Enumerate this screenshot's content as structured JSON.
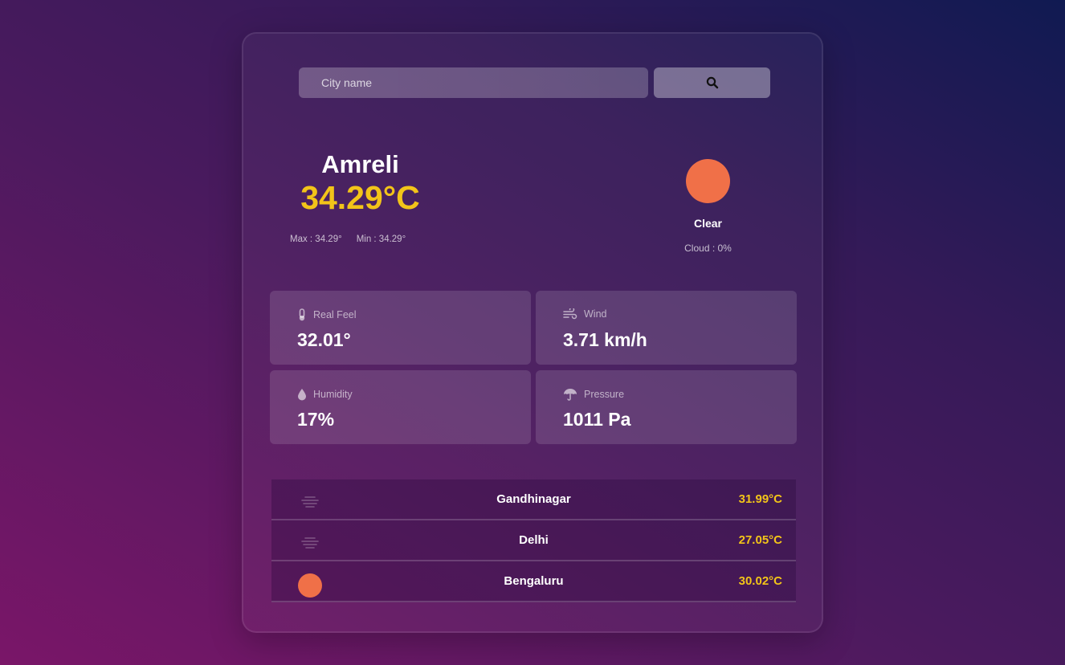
{
  "search": {
    "placeholder": "City name",
    "button_icon": "search-icon"
  },
  "current": {
    "city": "Amreli",
    "temperature": "34.29°C",
    "max": "Max : 34.29°",
    "min": "Min : 34.29°",
    "condition": "Clear",
    "condition_icon": "sun-icon",
    "cloud": "Cloud : 0%"
  },
  "details": [
    {
      "label": "Real Feel",
      "value": "32.01°",
      "icon": "thermometer-icon"
    },
    {
      "label": "Wind",
      "value": "3.71 km/h",
      "icon": "wind-icon"
    },
    {
      "label": "Humidity",
      "value": "17%",
      "icon": "droplet-icon"
    },
    {
      "label": "Pressure",
      "value": "1011 Pa",
      "icon": "umbrella-icon"
    }
  ],
  "cities": [
    {
      "name": "Gandhinagar",
      "temp": "31.99°C",
      "icon": "haze-icon"
    },
    {
      "name": "Delhi",
      "temp": "27.05°C",
      "icon": "haze-icon"
    },
    {
      "name": "Bengaluru",
      "temp": "30.02°C",
      "icon": "sun-icon"
    }
  ],
  "colors": {
    "accent": "#f2c419",
    "sun": "#f07048"
  }
}
